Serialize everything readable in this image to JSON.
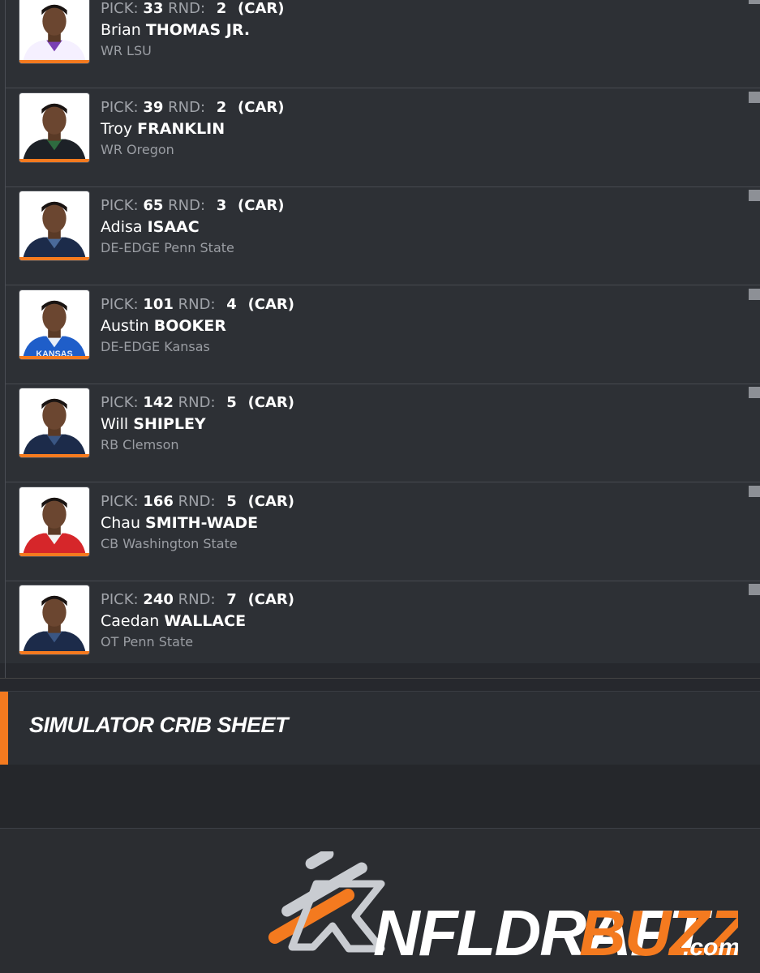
{
  "labels": {
    "pick": "PICK:",
    "round": "RND:"
  },
  "picks": [
    {
      "pick": "33",
      "round": "2",
      "team": "(CAR)",
      "first": "Brian",
      "last": "THOMAS JR.",
      "position_school": "WR LSU",
      "jersey_color": "#f5f0ff",
      "trim_color": "#7a3fb3"
    },
    {
      "pick": "39",
      "round": "2",
      "team": "(CAR)",
      "first": "Troy",
      "last": "FRANKLIN",
      "position_school": "WR Oregon",
      "jersey_color": "#1d2127",
      "trim_color": "#2e6b3f"
    },
    {
      "pick": "65",
      "round": "3",
      "team": "(CAR)",
      "first": "Adisa",
      "last": "ISAAC",
      "position_school": "DE-EDGE Penn State",
      "jersey_color": "#1c2b4a",
      "trim_color": "#4a6a9a"
    },
    {
      "pick": "101",
      "round": "4",
      "team": "(CAR)",
      "first": "Austin",
      "last": "BOOKER",
      "position_school": "DE-EDGE Kansas",
      "jersey_color": "#1f5ec9",
      "trim_color": "#e8eef8",
      "jersey_text": "KANSAS"
    },
    {
      "pick": "142",
      "round": "5",
      "team": "(CAR)",
      "first": "Will",
      "last": "SHIPLEY",
      "position_school": "RB Clemson",
      "jersey_color": "#1c2b4a",
      "trim_color": "#3a5683"
    },
    {
      "pick": "166",
      "round": "5",
      "team": "(CAR)",
      "first": "Chau",
      "last": "SMITH-WADE",
      "position_school": "CB Washington State",
      "jersey_color": "#d6262a",
      "trim_color": "#f2f2f2"
    },
    {
      "pick": "240",
      "round": "7",
      "team": "(CAR)",
      "first": "Caedan",
      "last": "WALLACE",
      "position_school": "OT Penn State",
      "jersey_color": "#1c2b4a",
      "trim_color": "#3a5683"
    }
  ],
  "section": {
    "title": "SIMULATOR CRIB SHEET"
  },
  "brand": {
    "name_a": "NFLDRAFT",
    "name_b": "BUZZ",
    "suffix": ".com",
    "accent": "#f47a1f",
    "mark_gray": "#c9ccd1"
  }
}
